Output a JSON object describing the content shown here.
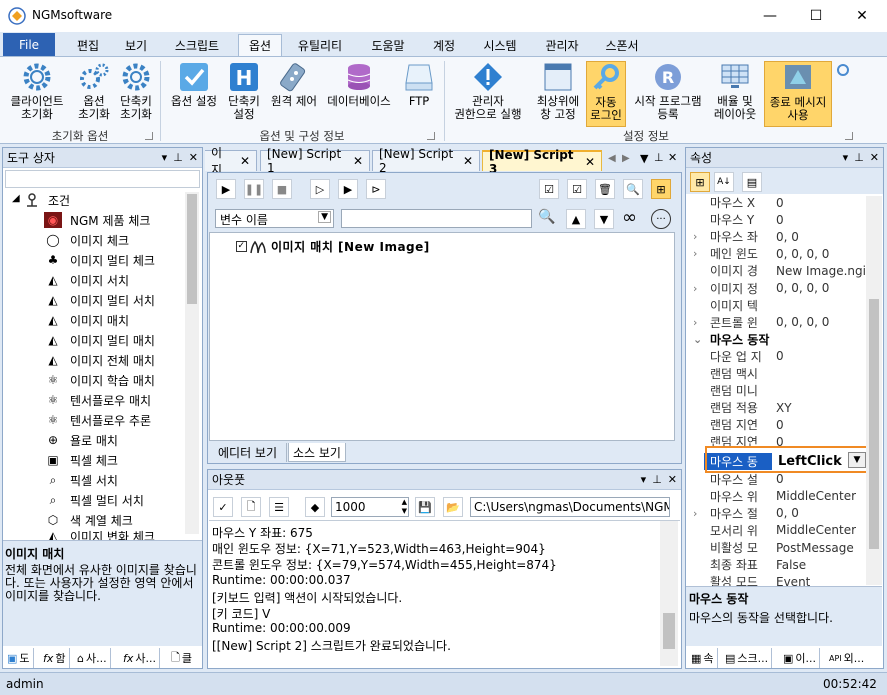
{
  "window": {
    "title": "NGMsoftware",
    "min": "—",
    "max": "☐",
    "close": "✕"
  },
  "ribbon_tabs": [
    "File",
    "편집",
    "보기",
    "스크립트",
    "옵션",
    "유틸리티",
    "도움말",
    "계정",
    "시스템",
    "관리자",
    "스폰서"
  ],
  "ribbon": {
    "group1": {
      "label": "초기화 옵션",
      "buttons": [
        "클라이언트\n초기화",
        "옵션\n초기화",
        "단축키\n초기화"
      ]
    },
    "group2": {
      "label": "옵션 및 구성 정보",
      "buttons": [
        "옵션 설정",
        "단축키\n설정",
        "원격 제어",
        "데이터베이스",
        "FTP"
      ]
    },
    "group3": {
      "label": "설정 정보",
      "buttons": [
        "관리자\n권한으로 실행",
        "최상위에\n창 고정",
        "자동\n로그인",
        "시작 프로그램\n등록",
        "배율 및\n레이아웃",
        "종료 메시지\n사용"
      ]
    }
  },
  "toolbox": {
    "title": "도구 상자",
    "root": "조건",
    "items": [
      "NGM 제품 체크",
      "이미지 체크",
      "이미지 멀티 체크",
      "이미지 서치",
      "이미지 멀티 서치",
      "이미지 매치",
      "이미지 멀티 매치",
      "이미지 전체 매치",
      "이미지 학습 매치",
      "텐서플로우 매치",
      "텐서플로우 추론",
      "욜로 매치",
      "픽셀 체크",
      "픽셀 서치",
      "픽셀 멀티 서치",
      "색 계열 체크",
      "이미지 변화 체크"
    ],
    "desc_title": "이미지 매치",
    "desc_text": "전체 화면에서 유사한 이미지를 찾습니다. 또는 사용자가 설정한 영역 안에서 이미지를 찾습니다.",
    "bottom_tabs": [
      "도",
      "함",
      "사...",
      "사...",
      "클"
    ]
  },
  "doc_tabs": [
    "이지",
    "[New] Script 1",
    "[New] Script 2",
    "[New] Script 3"
  ],
  "editor": {
    "var_select": "변수 이름",
    "search_value": "",
    "node_label": "이미지 매치 [New Image]",
    "view_tabs": [
      "에디터 보기",
      "소스 보기"
    ]
  },
  "output": {
    "title": "아웃풋",
    "count": "1000",
    "path": "C:\\Users\\ngmas\\Documents\\NGM6\\",
    "lines": [
      "마우스 Y 좌표: 675",
      "매인 윈도우 정보: {X=71,Y=523,Width=463,Height=904}",
      "콘트롤 윈도우 정보: {X=79,Y=574,Width=455,Height=874}",
      "Runtime: 00:00:00.037",
      "[키보드 입력] 액션이 시작되었습니다.",
      "[키 코드] V",
      "Runtime: 00:00:00.009",
      "[[New] Script 2] 스크립트가 완료되었습니다."
    ]
  },
  "properties": {
    "title": "속성",
    "rows": [
      {
        "name": "마우스 X",
        "value": "0",
        "exp": ""
      },
      {
        "name": "마우스 Y",
        "value": "0",
        "exp": ""
      },
      {
        "name": "마우스 좌",
        "value": "0, 0",
        "exp": ">"
      },
      {
        "name": "메인 윈도",
        "value": "0, 0, 0, 0",
        "exp": ">"
      },
      {
        "name": "이미지 경",
        "value": "New Image.ngi",
        "exp": ""
      },
      {
        "name": "이미지 정",
        "value": "0, 0, 0, 0",
        "exp": ">"
      },
      {
        "name": "이미지 텍",
        "value": "",
        "exp": ""
      },
      {
        "name": "콘트롤 윈",
        "value": "0, 0, 0, 0",
        "exp": ">"
      },
      {
        "name": "마우스 동작",
        "value": "",
        "exp": "v",
        "cat": true
      },
      {
        "name": "다운 업 지",
        "value": "0",
        "exp": ""
      },
      {
        "name": "랜덤 맥시",
        "value": "",
        "exp": ""
      },
      {
        "name": "랜덤 미니",
        "value": "",
        "exp": ""
      },
      {
        "name": "랜덤 적용",
        "value": "XY",
        "exp": ""
      },
      {
        "name": "랜덤 지연",
        "value": "0",
        "exp": ""
      },
      {
        "name": "랜덤 지연",
        "value": "0",
        "exp": ""
      },
      {
        "name": "마우스 동",
        "value": "LeftClick",
        "exp": "",
        "selected": true
      },
      {
        "name": "마우스 설",
        "value": "0",
        "exp": ""
      },
      {
        "name": "마우스 위",
        "value": "MiddleCenter",
        "exp": ""
      },
      {
        "name": "마우스 절",
        "value": "0, 0",
        "exp": ">"
      },
      {
        "name": "모서리 위",
        "value": "MiddleCenter",
        "exp": ""
      },
      {
        "name": "비활성 모",
        "value": "PostMessage",
        "exp": ""
      },
      {
        "name": "최종 좌표",
        "value": "False",
        "exp": ""
      },
      {
        "name": "활성 모드",
        "value": "Event",
        "exp": ""
      }
    ],
    "desc_title": "마우스 동작",
    "desc_text": "마우스의 동작을 선택합니다.",
    "bottom_tabs": [
      "속",
      "스크...",
      "이...",
      "외..."
    ]
  },
  "status": {
    "user": "admin",
    "time": "00:52:42"
  }
}
